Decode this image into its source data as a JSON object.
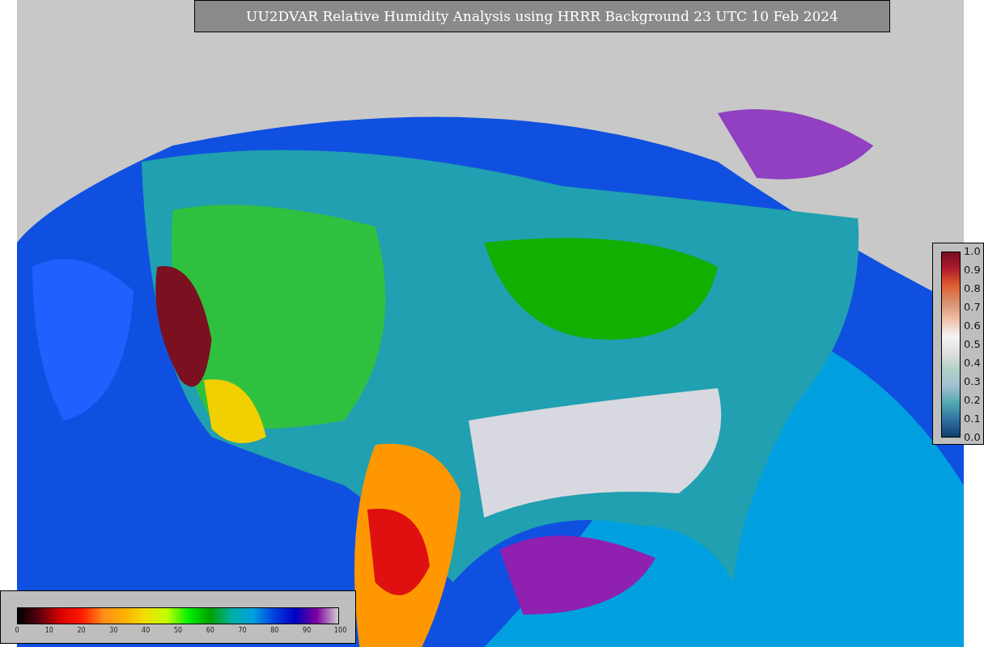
{
  "title": "UU2DVAR Relative Humidity Analysis using HRRR Background 23 UTC 10 Feb 2024",
  "humidity_colorbar": {
    "ticks": [
      "0",
      "10",
      "20",
      "30",
      "40",
      "50",
      "60",
      "70",
      "80",
      "90",
      "100"
    ]
  },
  "station_colorbar": {
    "ticks": [
      "1.0",
      "0.9",
      "0.8",
      "0.7",
      "0.6",
      "0.5",
      "0.4",
      "0.3",
      "0.2",
      "0.1",
      "0.0"
    ]
  }
}
